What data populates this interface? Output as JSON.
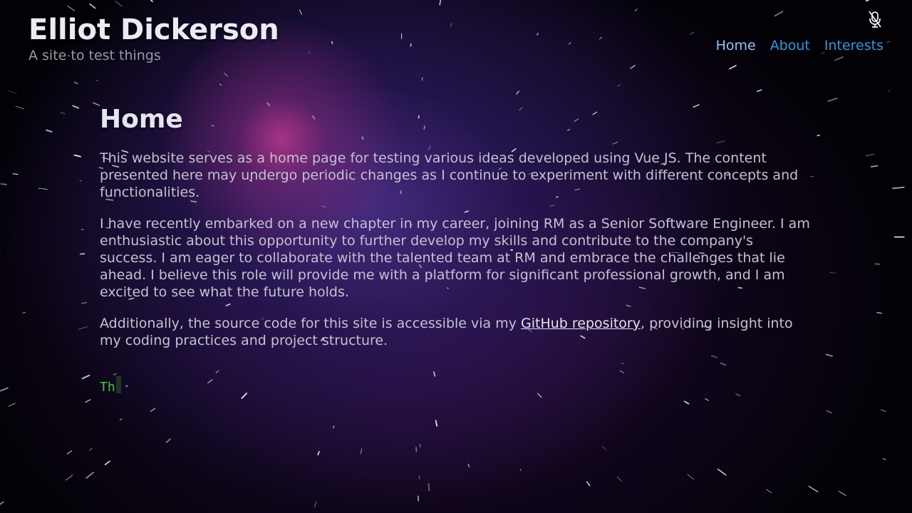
{
  "site": {
    "title": "Elliot Dickerson",
    "subtitle": "A site to test things"
  },
  "nav": {
    "items": [
      {
        "label": "Home",
        "active": true
      },
      {
        "label": "About",
        "active": false
      },
      {
        "label": "Interests",
        "active": false
      }
    ]
  },
  "toolbar": {
    "mic_icon": "microphone-off-icon"
  },
  "main": {
    "heading": "Home",
    "para1": "This website serves as a home page for testing various ideas developed using Vue JS. The content presented here may undergo periodic changes as I continue to experiment with different concepts and functionalities.",
    "para2": "I have recently embarked on a new chapter in my career, joining RM as a Senior Software Engineer. I am enthusiastic about this opportunity to further develop my skills and contribute to the company's success. I am eager to collaborate with the talented team at RM and embrace the challenges that lie ahead. I believe this role will provide me with a platform for significant professional growth, and I am excited to see what the future holds.",
    "para3_before": "Additionally, the source code for this site is accessible via my ",
    "para3_link": "GitHub repository",
    "para3_after": ", providing insight into my coding practices and project structure."
  },
  "typing": {
    "text": "Th"
  },
  "colors": {
    "nav_link": "#2f9ae0",
    "nav_active": "#8fc3ff",
    "typing_text": "#33d42f",
    "background": "#020105"
  }
}
